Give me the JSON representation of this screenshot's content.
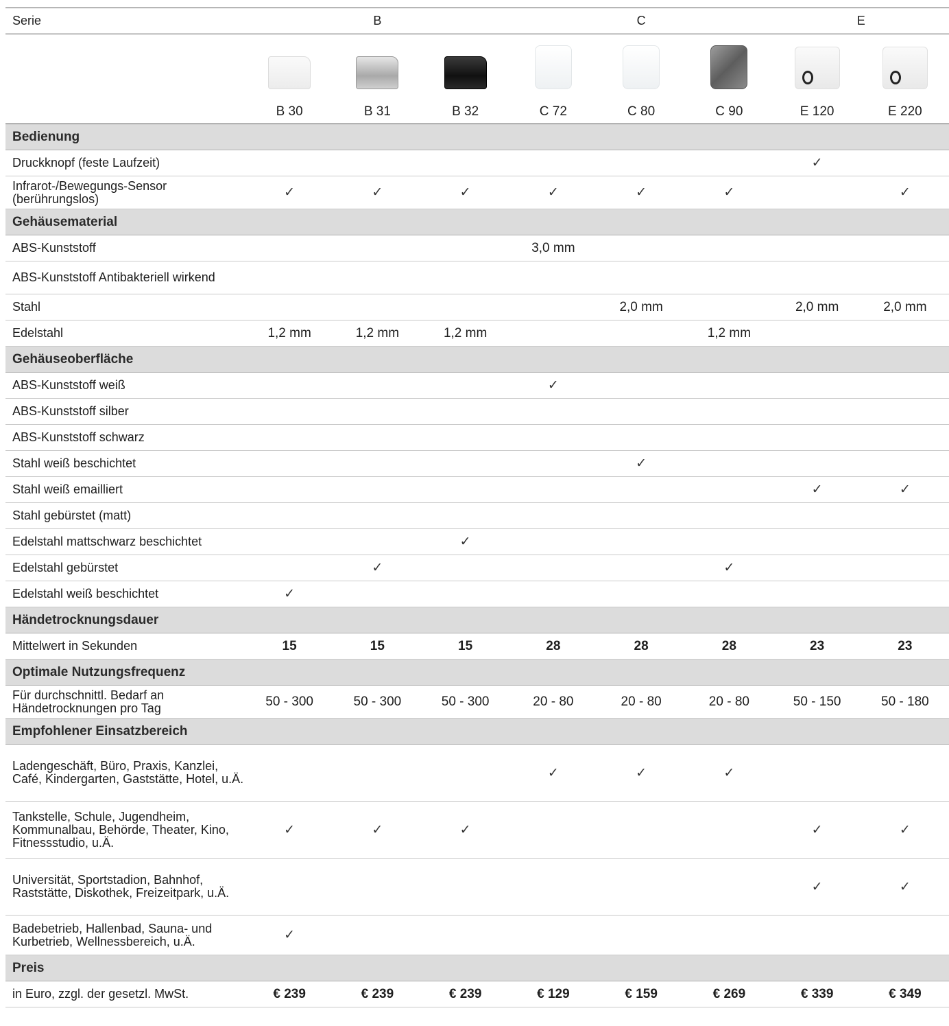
{
  "header": {
    "serie_label": "Serie",
    "series_groups": [
      {
        "name": "B"
      },
      {
        "name": "C"
      },
      {
        "name": "E"
      }
    ],
    "models": [
      {
        "name": "B 30",
        "image": "hand-dryer-white-box-icon"
      },
      {
        "name": "B 31",
        "image": "hand-dryer-silver-box-icon"
      },
      {
        "name": "B 32",
        "image": "hand-dryer-black-box-icon"
      },
      {
        "name": "C 72",
        "image": "hand-dryer-white-dome-icon"
      },
      {
        "name": "C 80",
        "image": "hand-dryer-white-dome-icon"
      },
      {
        "name": "C 90",
        "image": "hand-dryer-steel-dome-icon"
      },
      {
        "name": "E 120",
        "image": "hand-dryer-white-nozzle-icon"
      },
      {
        "name": "E 220",
        "image": "hand-dryer-white-nozzle-icon"
      }
    ]
  },
  "rows": [
    {
      "type": "section",
      "label": "Bedienung"
    },
    {
      "type": "data",
      "label": "Druckknopf (feste Laufzeit)",
      "cells": [
        "",
        "",
        "",
        "",
        "",
        "",
        "✓",
        ""
      ]
    },
    {
      "type": "data",
      "label": "Infrarot-/Bewegungs-Sensor (berührungslos)",
      "cells": [
        "✓",
        "✓",
        "✓",
        "✓",
        "✓",
        "✓",
        "",
        "✓"
      ]
    },
    {
      "type": "section",
      "label": "Gehäusematerial"
    },
    {
      "type": "data",
      "label": "ABS-Kunststoff",
      "cells": [
        "",
        "",
        "",
        "3,0 mm",
        "",
        "",
        "",
        ""
      ]
    },
    {
      "type": "data",
      "label": "ABS-Kunststoff Antibakteriell wirkend",
      "cells": [
        "",
        "",
        "",
        "",
        "",
        "",
        "",
        ""
      ]
    },
    {
      "type": "data",
      "label": "Stahl",
      "cells": [
        "",
        "",
        "",
        "",
        "2,0 mm",
        "",
        "2,0 mm",
        "2,0 mm"
      ]
    },
    {
      "type": "data",
      "label": "Edelstahl",
      "cells": [
        "1,2 mm",
        "1,2 mm",
        "1,2 mm",
        "",
        "",
        "1,2 mm",
        "",
        ""
      ]
    },
    {
      "type": "section",
      "label": "Gehäuseoberfläche"
    },
    {
      "type": "data",
      "label": "ABS-Kunststoff weiß",
      "cells": [
        "",
        "",
        "",
        "✓",
        "",
        "",
        "",
        ""
      ]
    },
    {
      "type": "data",
      "label": "ABS-Kunststoff silber",
      "cells": [
        "",
        "",
        "",
        "",
        "",
        "",
        "",
        ""
      ]
    },
    {
      "type": "data",
      "label": "ABS-Kunststoff schwarz",
      "cells": [
        "",
        "",
        "",
        "",
        "",
        "",
        "",
        ""
      ]
    },
    {
      "type": "data",
      "label": "Stahl weiß beschichtet",
      "cells": [
        "",
        "",
        "",
        "",
        "✓",
        "",
        "",
        ""
      ]
    },
    {
      "type": "data",
      "label": "Stahl weiß emailliert",
      "cells": [
        "",
        "",
        "",
        "",
        "",
        "",
        "✓",
        "✓"
      ]
    },
    {
      "type": "data",
      "label": "Stahl gebürstet (matt)",
      "cells": [
        "",
        "",
        "",
        "",
        "",
        "",
        "",
        ""
      ]
    },
    {
      "type": "data",
      "label": "Edelstahl mattschwarz beschichtet",
      "cells": [
        "",
        "",
        "✓",
        "",
        "",
        "",
        "",
        ""
      ]
    },
    {
      "type": "data",
      "label": "Edelstahl gebürstet",
      "cells": [
        "",
        "✓",
        "",
        "",
        "",
        "✓",
        "",
        ""
      ]
    },
    {
      "type": "data",
      "label": "Edelstahl weiß beschichtet",
      "cells": [
        "✓",
        "",
        "",
        "",
        "",
        "",
        "",
        ""
      ]
    },
    {
      "type": "section",
      "label": "Händetrocknungsdauer"
    },
    {
      "type": "data",
      "label": "Mittelwert in Sekunden",
      "bold": true,
      "cells": [
        "15",
        "15",
        "15",
        "28",
        "28",
        "28",
        "23",
        "23"
      ]
    },
    {
      "type": "section",
      "label": "Optimale Nutzungsfrequenz"
    },
    {
      "type": "data",
      "label": "Für durchschnittl. Bedarf an Händetrocknungen pro Tag",
      "cells": [
        "50 - 300",
        "50 - 300",
        "50 - 300",
        "20 - 80",
        "20 - 80",
        "20 - 80",
        "50 - 150",
        "50 - 180"
      ]
    },
    {
      "type": "section",
      "label": "Empfohlener Einsatzbereich"
    },
    {
      "type": "data",
      "label": "Ladengeschäft, Büro, Praxis, Kanzlei, Café, Kindergarten, Gaststätte, Hotel, u.Ä.",
      "cells": [
        "",
        "",
        "",
        "✓",
        "✓",
        "✓",
        "",
        ""
      ]
    },
    {
      "type": "data",
      "label": "Tankstelle, Schule, Jugendheim, Kommunalbau, Behörde, Theater, Kino, Fitnessstudio, u.Ä.",
      "cells": [
        "✓",
        "✓",
        "✓",
        "",
        "",
        "",
        "✓",
        "✓"
      ]
    },
    {
      "type": "data",
      "label": "Universität, Sportstadion, Bahnhof, Raststätte, Diskothek, Freizeitpark, u.Ä.",
      "cells": [
        "",
        "",
        "",
        "",
        "",
        "",
        "✓",
        "✓"
      ]
    },
    {
      "type": "data",
      "label": "Badebetrieb, Hallenbad, Sauna- und Kurbetrieb, Wellnessbereich, u.Ä.",
      "cells": [
        "✓",
        "",
        "",
        "",
        "",
        "",
        "",
        ""
      ]
    },
    {
      "type": "section",
      "label": "Preis"
    },
    {
      "type": "data",
      "label": "in Euro, zzgl. der gesetzl. MwSt.",
      "bold": true,
      "cells": [
        "€ 239",
        "€ 239",
        "€ 239",
        "€ 129",
        "€ 159",
        "€ 269",
        "€ 339",
        "€ 349"
      ]
    }
  ]
}
